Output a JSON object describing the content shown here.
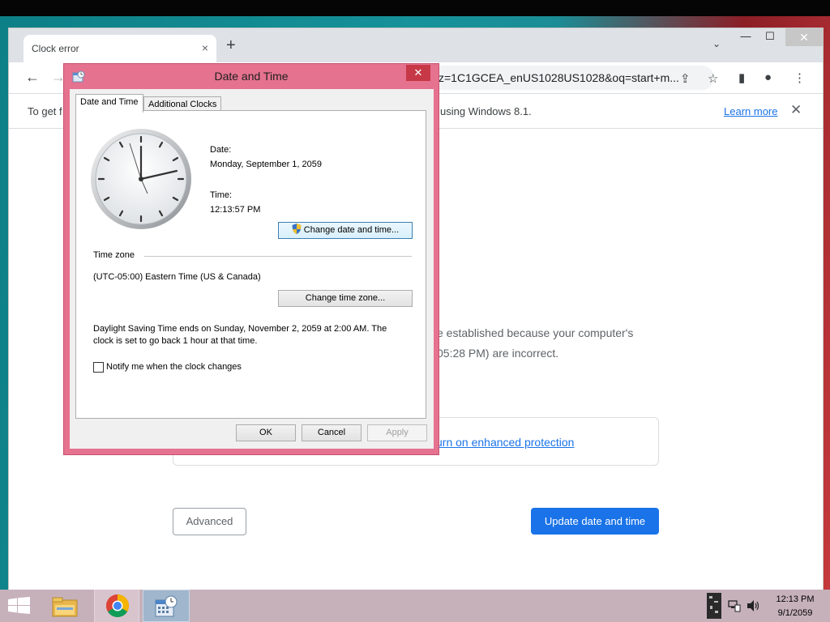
{
  "browser": {
    "tab_title": "Clock error",
    "tab_close": "×",
    "new_tab": "+",
    "tab_search": "⌄",
    "url_fragment": "z=1C1GCEA_enUS1028US1028&oq=start+m...",
    "infobar_text_left": "To get f",
    "infobar_text_right": "using Windows 8.1.",
    "learn_more": "Learn more",
    "infobar_close": "✕"
  },
  "page": {
    "body_line1": "e established because your computer's",
    "body_line2": "05:28 PM) are incorrect.",
    "protection_link": "urn on enhanced protection",
    "advanced_label": "Advanced",
    "update_label": "Update date and time"
  },
  "dialog": {
    "title": "Date and Time",
    "close": "✕",
    "tabs": [
      "Date and Time",
      "Additional Clocks"
    ],
    "date_label": "Date:",
    "date_value": "Monday, September 1, 2059",
    "time_label": "Time:",
    "time_value": "12:13:57 PM",
    "change_datetime_label": "Change date and time...",
    "timezone_header": "Time zone",
    "timezone_value": "(UTC-05:00) Eastern Time (US & Canada)",
    "change_timezone_label": "Change time zone...",
    "dst_line1": "Daylight Saving Time ends on Sunday, November 2, 2059 at 2:00 AM. The",
    "dst_line2": "clock is set to go back 1 hour at that time.",
    "notify_label": "Notify me when the clock changes",
    "notify_checked": false,
    "ok_label": "OK",
    "cancel_label": "Cancel",
    "apply_label": "Apply"
  },
  "taskbar": {
    "clock_time": "12:13 PM",
    "clock_date": "9/1/2059"
  },
  "colors": {
    "dialog_frame": "#e5728f",
    "dialog_close": "#c73847",
    "chrome_accent": "#1a73e8",
    "taskbar": "#c6b1bb"
  }
}
